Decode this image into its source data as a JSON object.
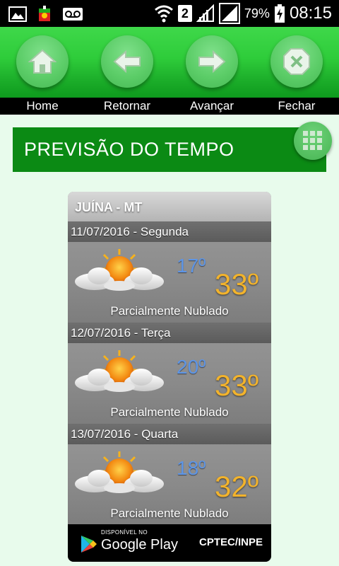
{
  "status_bar": {
    "battery_percent": "79%",
    "sim_slot": "2",
    "time": "08:15",
    "icons": [
      "image-icon",
      "app-flag-icon",
      "voicemail-icon",
      "wifi-icon",
      "signal-icon",
      "signal-icon",
      "battery-charging-icon"
    ]
  },
  "toolbar": {
    "home_label": "Home",
    "back_label": "Retornar",
    "forward_label": "Avançar",
    "close_label": "Fechar"
  },
  "header": {
    "title": "PREVISÃO DO TEMPO"
  },
  "widget": {
    "location": "JUÍNA - MT",
    "days": [
      {
        "date": "11/07/2016 - Segunda",
        "min": "17º",
        "max": "33º",
        "description": "Parcialmente Nublado",
        "icon": "partly-cloudy-icon"
      },
      {
        "date": "12/07/2016 - Terça",
        "min": "20º",
        "max": "33º",
        "description": "Parcialmente Nublado",
        "icon": "partly-cloudy-icon"
      },
      {
        "date": "13/07/2016 - Quarta",
        "min": "18º",
        "max": "32º",
        "description": "Parcialmente Nublado",
        "icon": "partly-cloudy-icon"
      }
    ],
    "footer": {
      "play_small": "DISPONÍVEL NO",
      "play_big": "Google Play",
      "source": "CPTEC/INPE"
    }
  },
  "colors": {
    "toolbar_green": "#2ecc3a",
    "header_green": "#0b8a14",
    "min_temp": "#5d95e6",
    "max_temp": "#f2b32c",
    "page_bg": "#e8fbec"
  }
}
